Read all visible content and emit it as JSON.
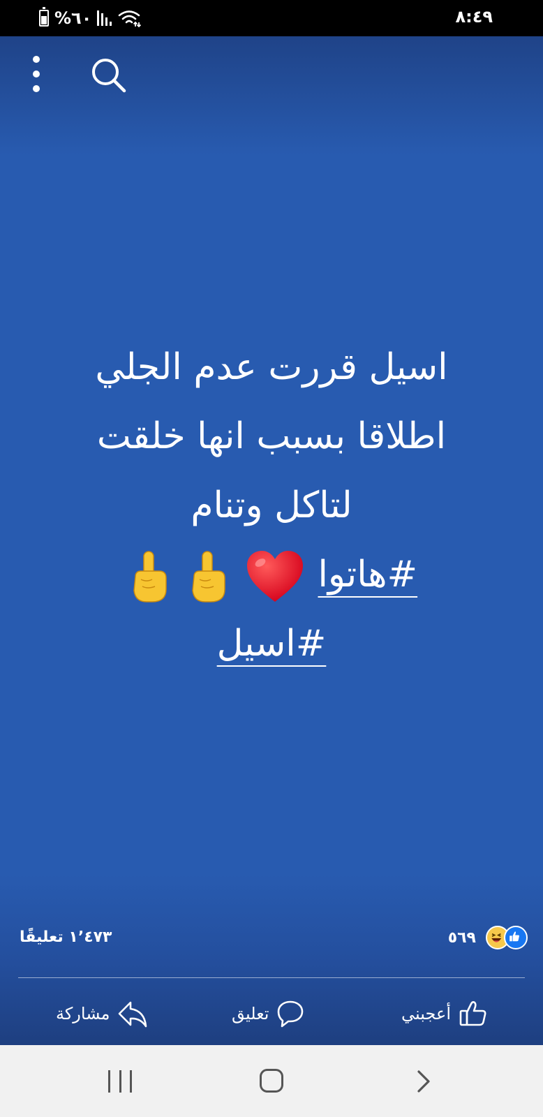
{
  "status_bar": {
    "battery_text": "%٦٠",
    "time": "٨:٤٩"
  },
  "post": {
    "lines": [
      "اسيل قررت عدم الجلي",
      "اطلاقا بسبب انها خلقت",
      "لتاكل وتنام"
    ],
    "hashtag1": "#هاتوا",
    "hashtag2": "#اسيل",
    "emojis": [
      "heart",
      "index-pointing-up",
      "index-pointing-up"
    ],
    "background_color": "#285bb0"
  },
  "stats": {
    "reactions_count": "٥٦٩",
    "reaction_icons": [
      "like",
      "haha"
    ],
    "comments": "١٬٤٧٣ تعليقًا"
  },
  "actions": {
    "like_label": "أعجبني",
    "comment_label": "تعليق",
    "share_label": "مشاركة"
  }
}
